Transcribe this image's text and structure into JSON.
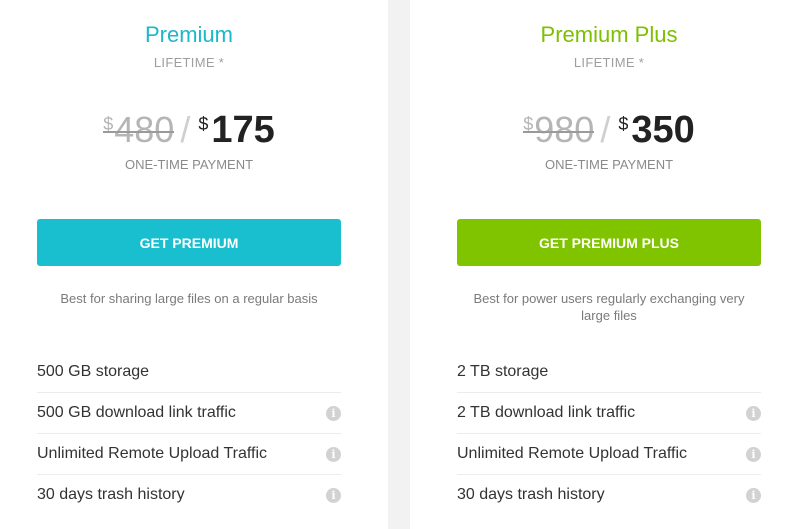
{
  "plans": [
    {
      "name": "Premium",
      "name_color": "#1ab8c9",
      "term": "LIFETIME *",
      "currency": "$",
      "old_price": "480",
      "slash": "/",
      "new_price": "175",
      "payment_note": "ONE-TIME PAYMENT",
      "button_label": "GET PREMIUM",
      "button_color": "#1abfcf",
      "description": "Best for sharing large files on a regular basis",
      "features": [
        {
          "label": "500 GB storage",
          "info": false
        },
        {
          "label": "500 GB download link traffic",
          "info": true,
          "icon": "info-icon"
        },
        {
          "label": "Unlimited Remote Upload Traffic",
          "info": true,
          "icon": "info-icon"
        },
        {
          "label": "30 days trash history",
          "info": true,
          "icon": "info-icon"
        }
      ]
    },
    {
      "name": "Premium Plus",
      "name_color": "#7cc000",
      "term": "LIFETIME *",
      "currency": "$",
      "old_price": "980",
      "slash": "/",
      "new_price": "350",
      "payment_note": "ONE-TIME PAYMENT",
      "button_label": "GET PREMIUM PLUS",
      "button_color": "#80c400",
      "description": "Best for power users regularly exchanging very large files",
      "features": [
        {
          "label": "2 TB storage",
          "info": false
        },
        {
          "label": "2 TB download link traffic",
          "info": true,
          "icon": "info-icon"
        },
        {
          "label": "Unlimited Remote Upload Traffic",
          "info": true,
          "icon": "info-icon"
        },
        {
          "label": "30 days trash history",
          "info": true,
          "icon": "info-icon"
        }
      ]
    }
  ],
  "info_glyph": "i"
}
